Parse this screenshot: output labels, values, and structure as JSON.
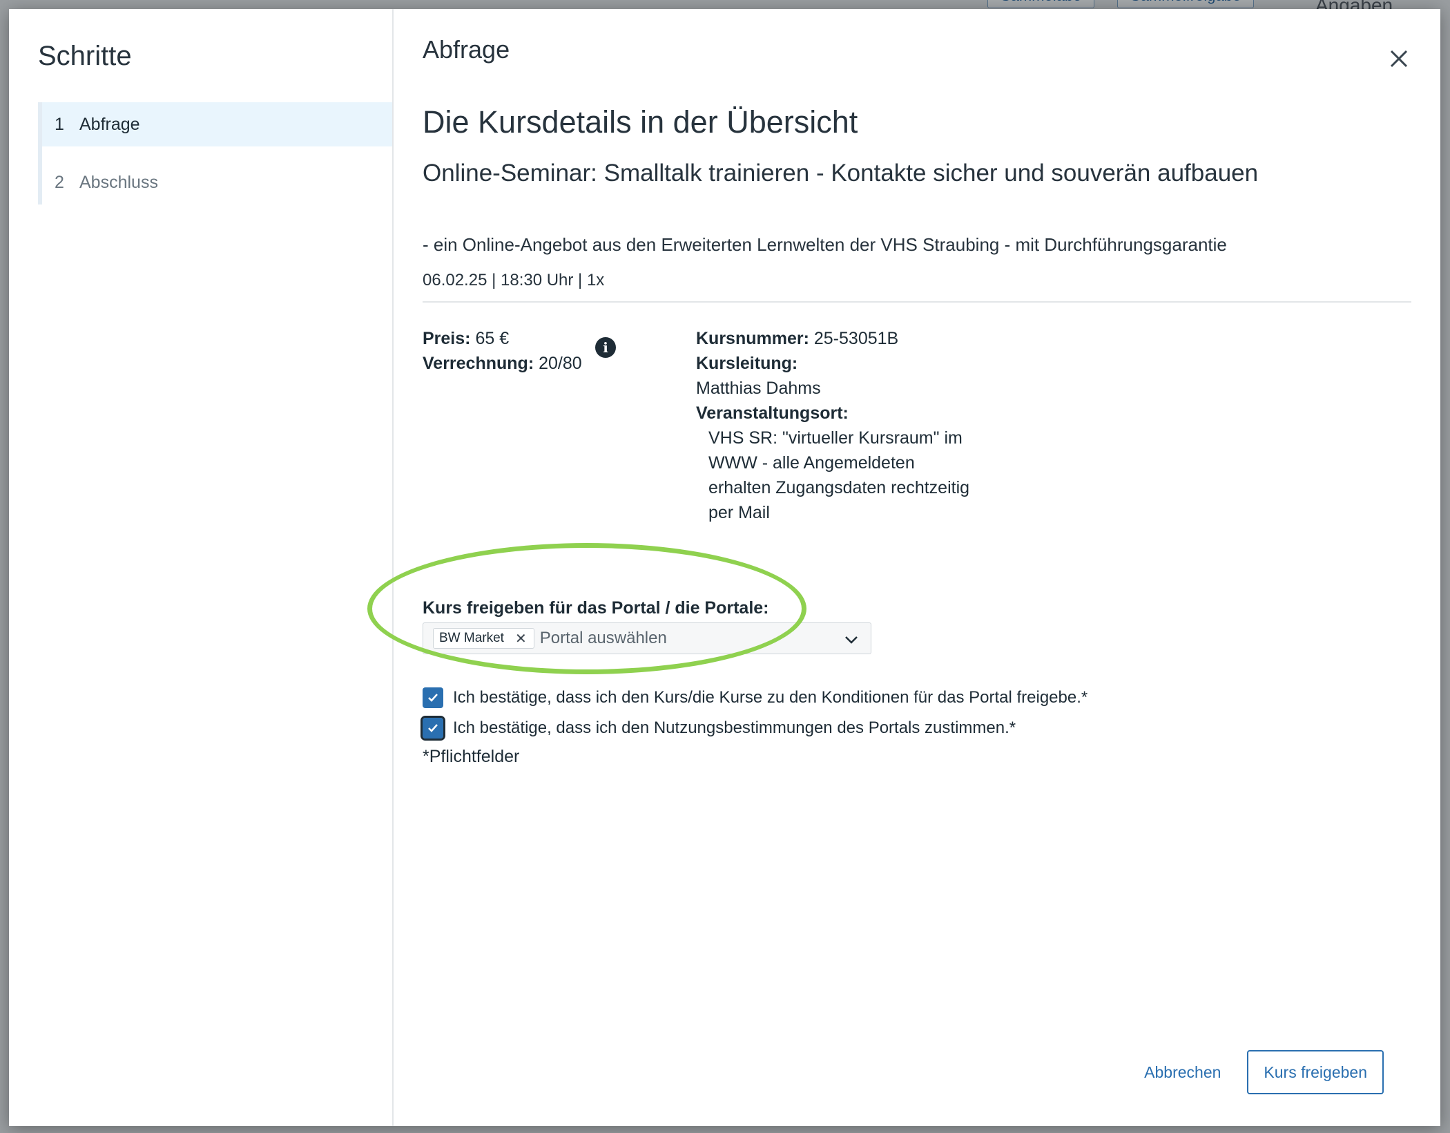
{
  "background": {
    "buttons": [
      "Sammelabo",
      "Sammelfreigabe"
    ],
    "header_text": "Angaben"
  },
  "sidebar": {
    "title": "Schritte",
    "steps": [
      {
        "num": "1",
        "label": "Abfrage",
        "active": true
      },
      {
        "num": "2",
        "label": "Abschluss",
        "active": false
      }
    ]
  },
  "main": {
    "header": "Abfrage",
    "heading": "Die Kursdetails in der Übersicht",
    "course_title": "Online-Seminar: Smalltalk trainieren - Kontakte sicher und souverän aufbauen",
    "tagline": "- ein Online-Angebot aus den Erweiterten Lernwelten der VHS Straubing - mit Durchführungsgarantie",
    "dateline": "06.02.25 | 18:30 Uhr | 1x",
    "price_label": "Preis:",
    "price_value": "65 €",
    "billing_label": "Verrechnung:",
    "billing_value": "20/80",
    "course_number_label": "Kursnummer:",
    "course_number_value": "25-53051B",
    "instructor_label": "Kursleitung:",
    "instructor_value": "Matthias Dahms",
    "venue_label": "Veranstaltungsort:",
    "venue_value": "VHS SR: \"virtueller Kursraum\" im WWW - alle Angemeldeten erhalten Zugangsdaten rechtzeitig per Mail",
    "portal_label": "Kurs freigeben für das Portal / die Portale:",
    "portal_chip": "BW Market",
    "portal_placeholder": "Portal auswählen",
    "confirm_conditions": "Ich bestätige, dass ich den Kurs/die Kurse zu den Konditionen für das Portal freigebe.*",
    "confirm_terms": "Ich bestätige, dass ich den Nutzungsbestimmungen des Portals zustimmen.*",
    "required_note": "*Pflichtfelder"
  },
  "footer": {
    "cancel_label": "Abbrechen",
    "submit_label": "Kurs freigeben"
  },
  "colors": {
    "accent": "#2a6fb0",
    "highlight_ring": "#8fd14f",
    "active_step_bg": "#e9f5fd"
  }
}
